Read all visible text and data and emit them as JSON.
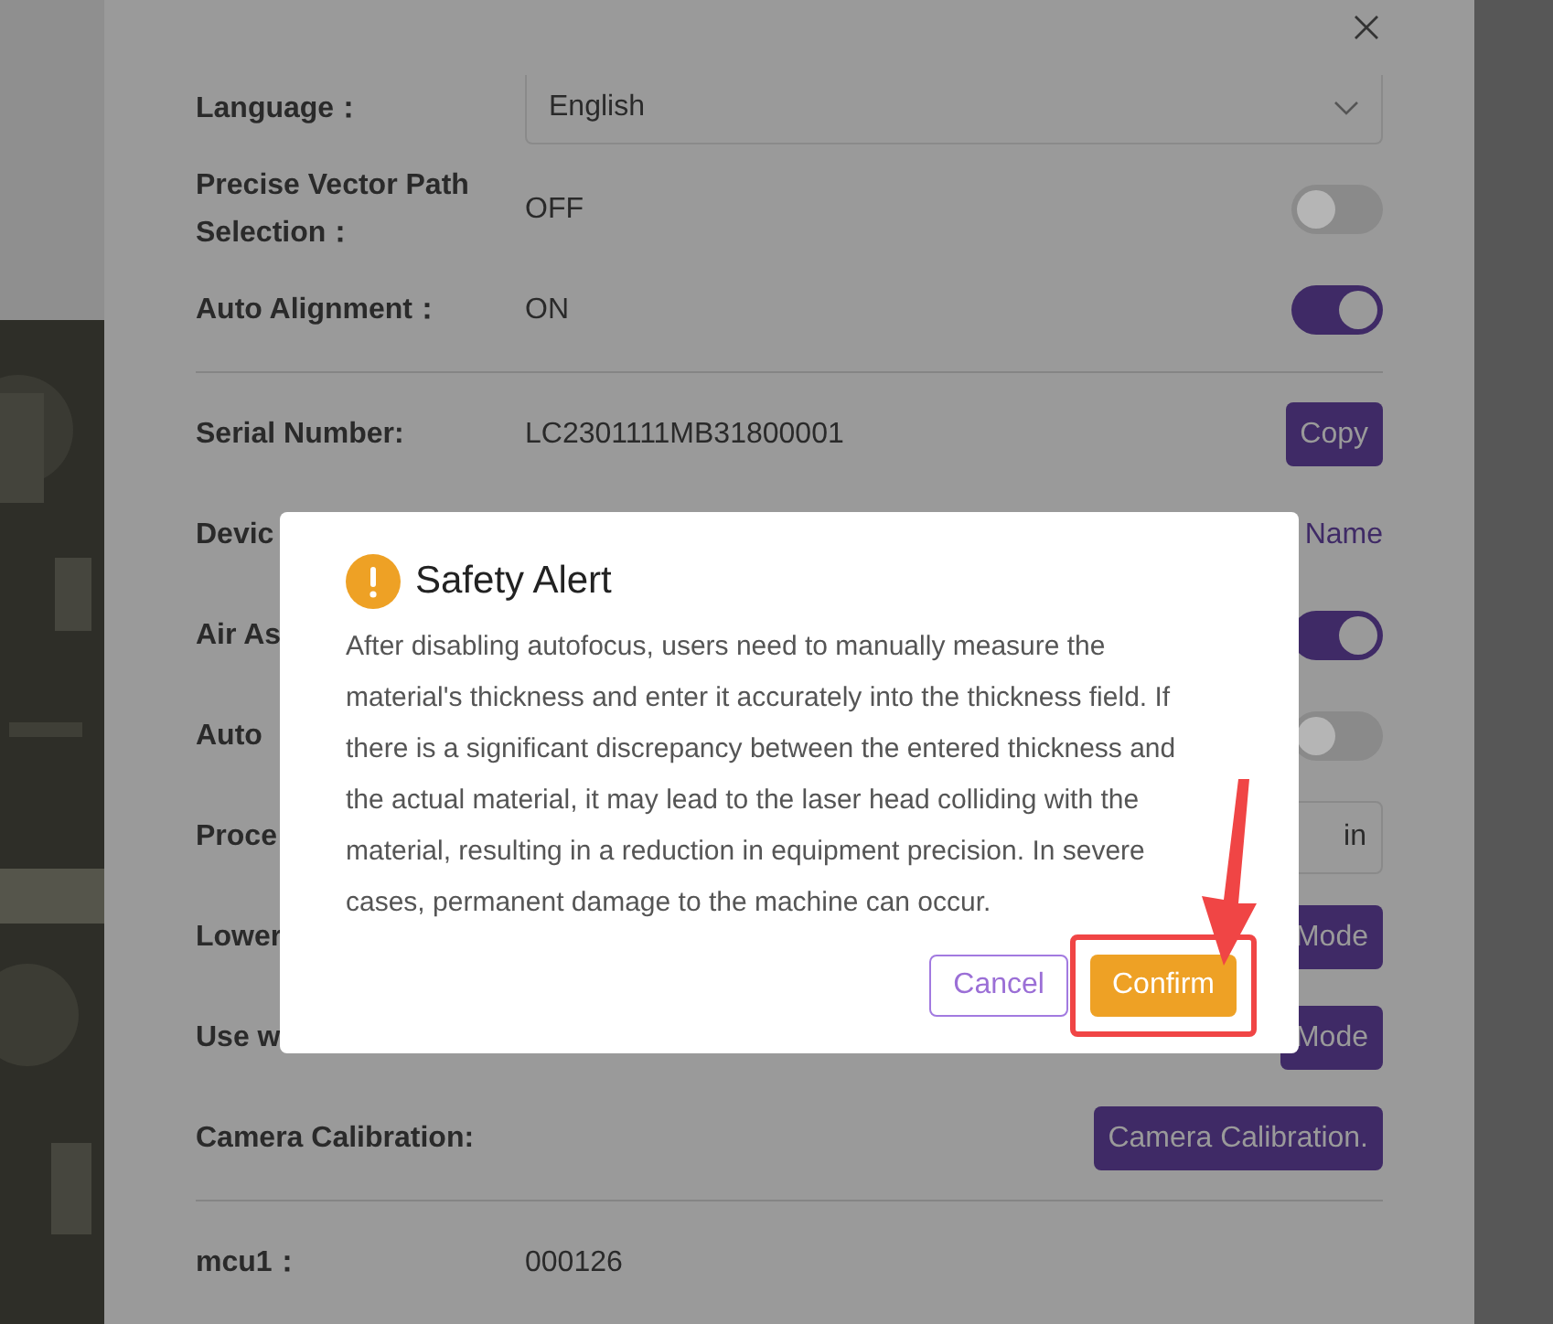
{
  "settings": {
    "sections": [
      [
        {
          "kind": "select",
          "label": "Language：",
          "value": "English"
        },
        {
          "kind": "toggle",
          "label": "Precise Vector Path Selection：",
          "value": "OFF",
          "on": false
        },
        {
          "kind": "toggle",
          "label": "Auto Alignment：",
          "value": "ON",
          "on": true
        }
      ],
      [
        {
          "kind": "button",
          "label": "Serial Number:",
          "value": "LC2301111MB31800001",
          "button": "Copy"
        },
        {
          "kind": "link",
          "label": "Devic",
          "link": "Name"
        },
        {
          "kind": "toggle",
          "label": "Air As",
          "on": true
        },
        {
          "kind": "toggle",
          "label": "Auto",
          "on": false
        },
        {
          "kind": "unit",
          "label": "Proce",
          "unit": "in"
        },
        {
          "kind": "button",
          "label": "Lower",
          "button": "Mode"
        },
        {
          "kind": "button",
          "label": "Use w",
          "button": "Mode"
        },
        {
          "kind": "button",
          "label": "Camera Calibration:",
          "button": "Camera Calibration."
        }
      ],
      [
        {
          "kind": "text",
          "label": "mcu1：",
          "value": "000126"
        }
      ]
    ]
  },
  "alert": {
    "title": "Safety Alert",
    "message": "After disabling autofocus, users need to manually measure the material's thickness and enter it accurately into the thickness field. If there is a significant discrepancy between the entered thickness and the actual material, it may lead to the laser head colliding with the material, resulting in a reduction in equipment precision. In severe cases, permanent damage to the machine can occur.",
    "buttons": [
      {
        "label": "Cancel",
        "kind": "secondary"
      },
      {
        "label": "Confirm",
        "kind": "primary",
        "highlighted": true
      }
    ]
  }
}
